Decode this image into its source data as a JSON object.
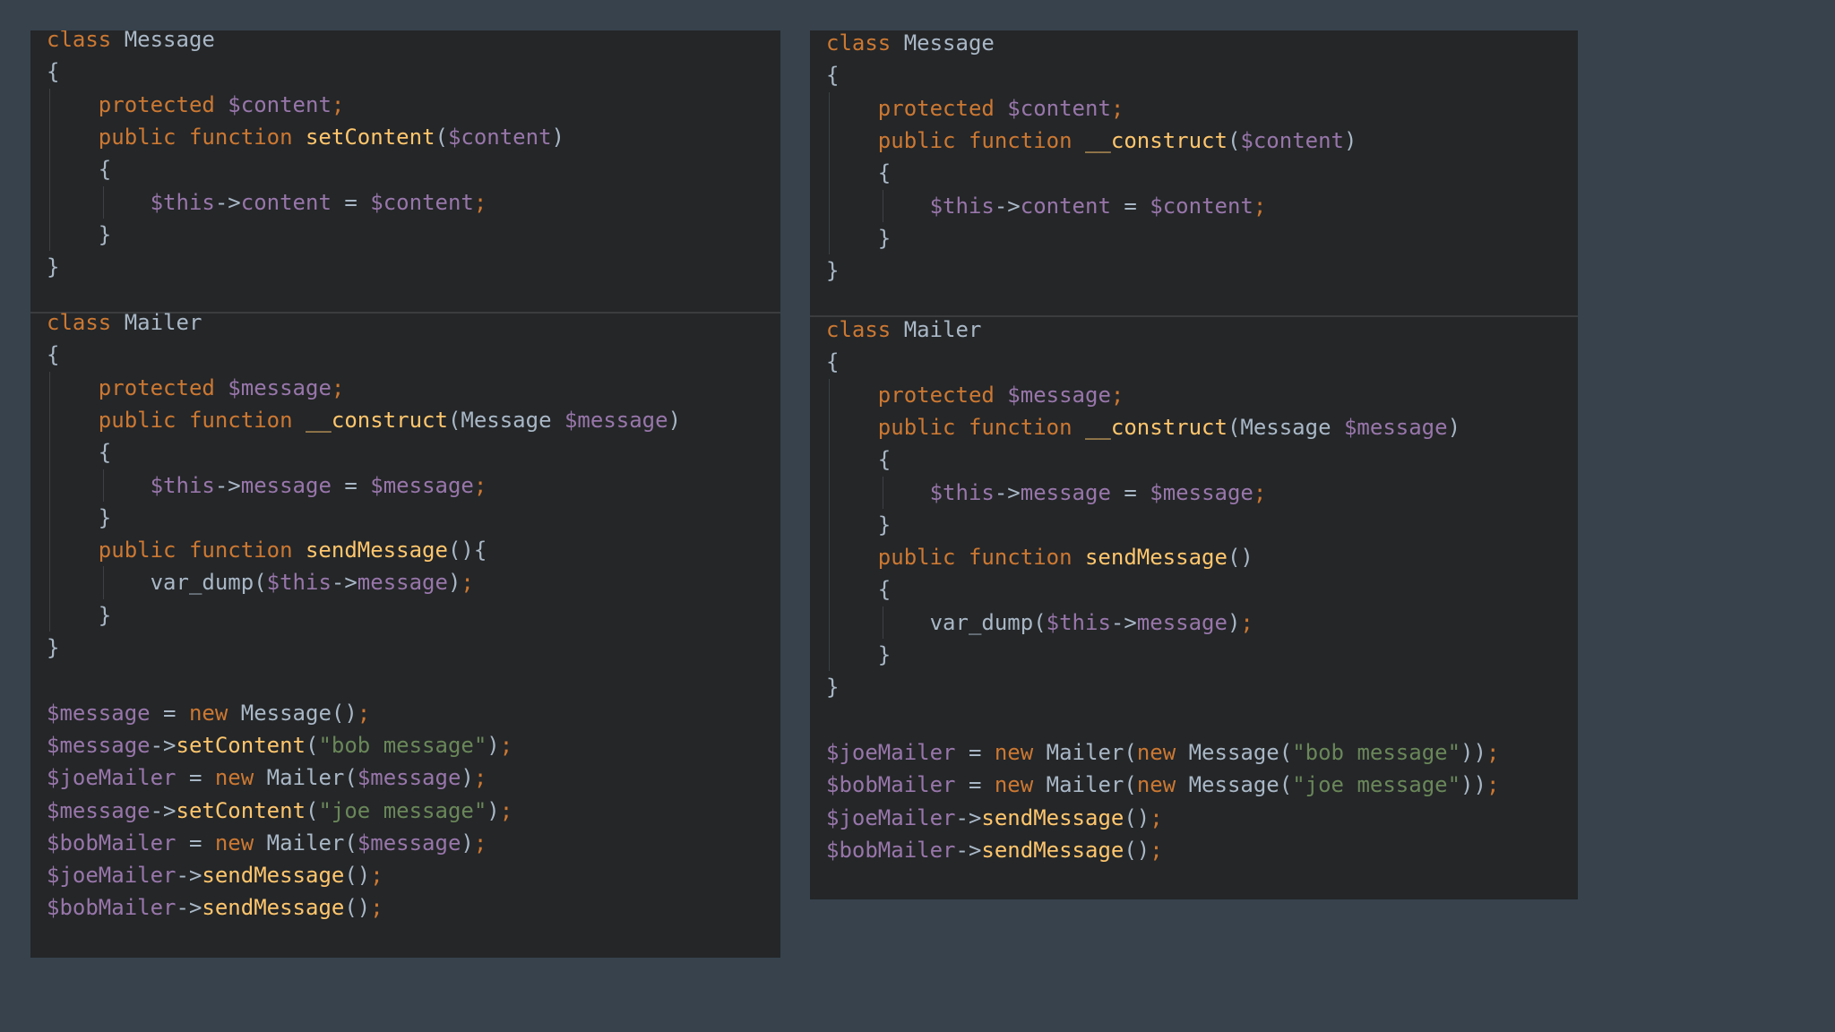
{
  "theme": {
    "background": "#37424d",
    "panel": "#242628",
    "keyword": "#cc7832",
    "variable": "#9876aa",
    "function": "#ffc66d",
    "string": "#6a8759",
    "text": "#a9b7c6"
  },
  "panels": [
    {
      "name": "code-panel-left",
      "blocks": [
        {
          "name": "message-class-block",
          "lines": [
            [
              [
                "kw",
                "class "
              ],
              [
                "txt",
                "Message"
              ]
            ],
            [
              [
                "txt",
                "{"
              ]
            ],
            [
              [
                "txt",
                "    "
              ],
              [
                "kw",
                "protected "
              ],
              [
                "var",
                "$content"
              ],
              [
                "punc",
                ";"
              ]
            ],
            [
              [
                "txt",
                "    "
              ],
              [
                "kw",
                "public function "
              ],
              [
                "fn",
                "setContent"
              ],
              [
                "txt",
                "("
              ],
              [
                "var",
                "$content"
              ],
              [
                "txt",
                ")"
              ]
            ],
            [
              [
                "txt",
                "    {"
              ]
            ],
            [
              [
                "txt",
                "        "
              ],
              [
                "var",
                "$this"
              ],
              [
                "txt",
                "->"
              ],
              [
                "var",
                "content"
              ],
              [
                "txt",
                " = "
              ],
              [
                "var",
                "$content"
              ],
              [
                "punc",
                ";"
              ]
            ],
            [
              [
                "txt",
                "    }"
              ]
            ],
            [
              [
                "txt",
                "}"
              ]
            ]
          ]
        },
        {
          "name": "mailer-class-block",
          "lines": [
            [
              [
                "kw",
                "class "
              ],
              [
                "txt",
                "Mailer"
              ]
            ],
            [
              [
                "txt",
                "{"
              ]
            ],
            [
              [
                "txt",
                "    "
              ],
              [
                "kw",
                "protected "
              ],
              [
                "var",
                "$message"
              ],
              [
                "punc",
                ";"
              ]
            ],
            [
              [
                "txt",
                "    "
              ],
              [
                "kw",
                "public function "
              ],
              [
                "fn",
                "__construct"
              ],
              [
                "txt",
                "(Message "
              ],
              [
                "var",
                "$message"
              ],
              [
                "txt",
                ")"
              ]
            ],
            [
              [
                "txt",
                "    {"
              ]
            ],
            [
              [
                "txt",
                "        "
              ],
              [
                "var",
                "$this"
              ],
              [
                "txt",
                "->"
              ],
              [
                "var",
                "message"
              ],
              [
                "txt",
                " = "
              ],
              [
                "var",
                "$message"
              ],
              [
                "punc",
                ";"
              ]
            ],
            [
              [
                "txt",
                "    }"
              ]
            ],
            [
              [
                "txt",
                "    "
              ],
              [
                "kw",
                "public function "
              ],
              [
                "fn",
                "sendMessage"
              ],
              [
                "txt",
                "(){"
              ]
            ],
            [
              [
                "txt",
                "        var_dump("
              ],
              [
                "var",
                "$this"
              ],
              [
                "txt",
                "->"
              ],
              [
                "var",
                "message"
              ],
              [
                "txt",
                ")"
              ],
              [
                "punc",
                ";"
              ]
            ],
            [
              [
                "txt",
                "    }"
              ]
            ],
            [
              [
                "txt",
                "}"
              ]
            ],
            [
              [
                "txt",
                ""
              ]
            ],
            [
              [
                "var",
                "$message"
              ],
              [
                "txt",
                " = "
              ],
              [
                "kw",
                "new "
              ],
              [
                "txt",
                "Message()"
              ],
              [
                "punc",
                ";"
              ]
            ],
            [
              [
                "var",
                "$message"
              ],
              [
                "txt",
                "->"
              ],
              [
                "fn",
                "setContent"
              ],
              [
                "txt",
                "("
              ],
              [
                "str",
                "\"bob message\""
              ],
              [
                "txt",
                ")"
              ],
              [
                "punc",
                ";"
              ]
            ],
            [
              [
                "var",
                "$joeMailer"
              ],
              [
                "txt",
                " = "
              ],
              [
                "kw",
                "new "
              ],
              [
                "txt",
                "Mailer("
              ],
              [
                "var",
                "$message"
              ],
              [
                "txt",
                ")"
              ],
              [
                "punc",
                ";"
              ]
            ],
            [
              [
                "var",
                "$message"
              ],
              [
                "txt",
                "->"
              ],
              [
                "fn",
                "setContent"
              ],
              [
                "txt",
                "("
              ],
              [
                "str",
                "\"joe message\""
              ],
              [
                "txt",
                ")"
              ],
              [
                "punc",
                ";"
              ]
            ],
            [
              [
                "var",
                "$bobMailer"
              ],
              [
                "txt",
                " = "
              ],
              [
                "kw",
                "new "
              ],
              [
                "txt",
                "Mailer("
              ],
              [
                "var",
                "$message"
              ],
              [
                "txt",
                ")"
              ],
              [
                "punc",
                ";"
              ]
            ],
            [
              [
                "var",
                "$joeMailer"
              ],
              [
                "txt",
                "->"
              ],
              [
                "fn",
                "sendMessage"
              ],
              [
                "txt",
                "()"
              ],
              [
                "punc",
                ";"
              ]
            ],
            [
              [
                "var",
                "$bobMailer"
              ],
              [
                "txt",
                "->"
              ],
              [
                "fn",
                "sendMessage"
              ],
              [
                "txt",
                "()"
              ],
              [
                "punc",
                ";"
              ]
            ]
          ]
        }
      ]
    },
    {
      "name": "code-panel-right",
      "blocks": [
        {
          "name": "message-class-block",
          "lines": [
            [
              [
                "kw",
                "class "
              ],
              [
                "txt",
                "Message"
              ]
            ],
            [
              [
                "txt",
                "{"
              ]
            ],
            [
              [
                "txt",
                "    "
              ],
              [
                "kw",
                "protected "
              ],
              [
                "var",
                "$content"
              ],
              [
                "punc",
                ";"
              ]
            ],
            [
              [
                "txt",
                "    "
              ],
              [
                "kw",
                "public function "
              ],
              [
                "fn",
                "__construct"
              ],
              [
                "txt",
                "("
              ],
              [
                "var",
                "$content"
              ],
              [
                "txt",
                ")"
              ]
            ],
            [
              [
                "txt",
                "    {"
              ]
            ],
            [
              [
                "txt",
                "        "
              ],
              [
                "var",
                "$this"
              ],
              [
                "txt",
                "->"
              ],
              [
                "var",
                "content"
              ],
              [
                "txt",
                " = "
              ],
              [
                "var",
                "$content"
              ],
              [
                "punc",
                ";"
              ]
            ],
            [
              [
                "txt",
                "    }"
              ]
            ],
            [
              [
                "txt",
                "}"
              ]
            ]
          ]
        },
        {
          "name": "mailer-class-block",
          "lines": [
            [
              [
                "kw",
                "class "
              ],
              [
                "txt",
                "Mailer"
              ]
            ],
            [
              [
                "txt",
                "{"
              ]
            ],
            [
              [
                "txt",
                "    "
              ],
              [
                "kw",
                "protected "
              ],
              [
                "var",
                "$message"
              ],
              [
                "punc",
                ";"
              ]
            ],
            [
              [
                "txt",
                "    "
              ],
              [
                "kw",
                "public function "
              ],
              [
                "fn",
                "__construct"
              ],
              [
                "txt",
                "(Message "
              ],
              [
                "var",
                "$message"
              ],
              [
                "txt",
                ")"
              ]
            ],
            [
              [
                "txt",
                "    {"
              ]
            ],
            [
              [
                "txt",
                "        "
              ],
              [
                "var",
                "$this"
              ],
              [
                "txt",
                "->"
              ],
              [
                "var",
                "message"
              ],
              [
                "txt",
                " = "
              ],
              [
                "var",
                "$message"
              ],
              [
                "punc",
                ";"
              ]
            ],
            [
              [
                "txt",
                "    }"
              ]
            ],
            [
              [
                "txt",
                "    "
              ],
              [
                "kw",
                "public function "
              ],
              [
                "fn",
                "sendMessage"
              ],
              [
                "txt",
                "()"
              ]
            ],
            [
              [
                "txt",
                "    {"
              ]
            ],
            [
              [
                "txt",
                "        var_dump("
              ],
              [
                "var",
                "$this"
              ],
              [
                "txt",
                "->"
              ],
              [
                "var",
                "message"
              ],
              [
                "txt",
                ")"
              ],
              [
                "punc",
                ";"
              ]
            ],
            [
              [
                "txt",
                "    }"
              ]
            ],
            [
              [
                "txt",
                "}"
              ]
            ],
            [
              [
                "txt",
                ""
              ]
            ],
            [
              [
                "var",
                "$joeMailer"
              ],
              [
                "txt",
                " = "
              ],
              [
                "kw",
                "new "
              ],
              [
                "txt",
                "Mailer("
              ],
              [
                "kw",
                "new "
              ],
              [
                "txt",
                "Message("
              ],
              [
                "str",
                "\"bob message\""
              ],
              [
                "txt",
                "))"
              ],
              [
                "punc",
                ";"
              ]
            ],
            [
              [
                "var",
                "$bobMailer"
              ],
              [
                "txt",
                " = "
              ],
              [
                "kw",
                "new "
              ],
              [
                "txt",
                "Mailer("
              ],
              [
                "kw",
                "new "
              ],
              [
                "txt",
                "Message("
              ],
              [
                "str",
                "\"joe message\""
              ],
              [
                "txt",
                "))"
              ],
              [
                "punc",
                ";"
              ]
            ],
            [
              [
                "var",
                "$joeMailer"
              ],
              [
                "txt",
                "->"
              ],
              [
                "fn",
                "sendMessage"
              ],
              [
                "txt",
                "()"
              ],
              [
                "punc",
                ";"
              ]
            ],
            [
              [
                "var",
                "$bobMailer"
              ],
              [
                "txt",
                "->"
              ],
              [
                "fn",
                "sendMessage"
              ],
              [
                "txt",
                "()"
              ],
              [
                "punc",
                ";"
              ]
            ]
          ]
        }
      ]
    }
  ]
}
